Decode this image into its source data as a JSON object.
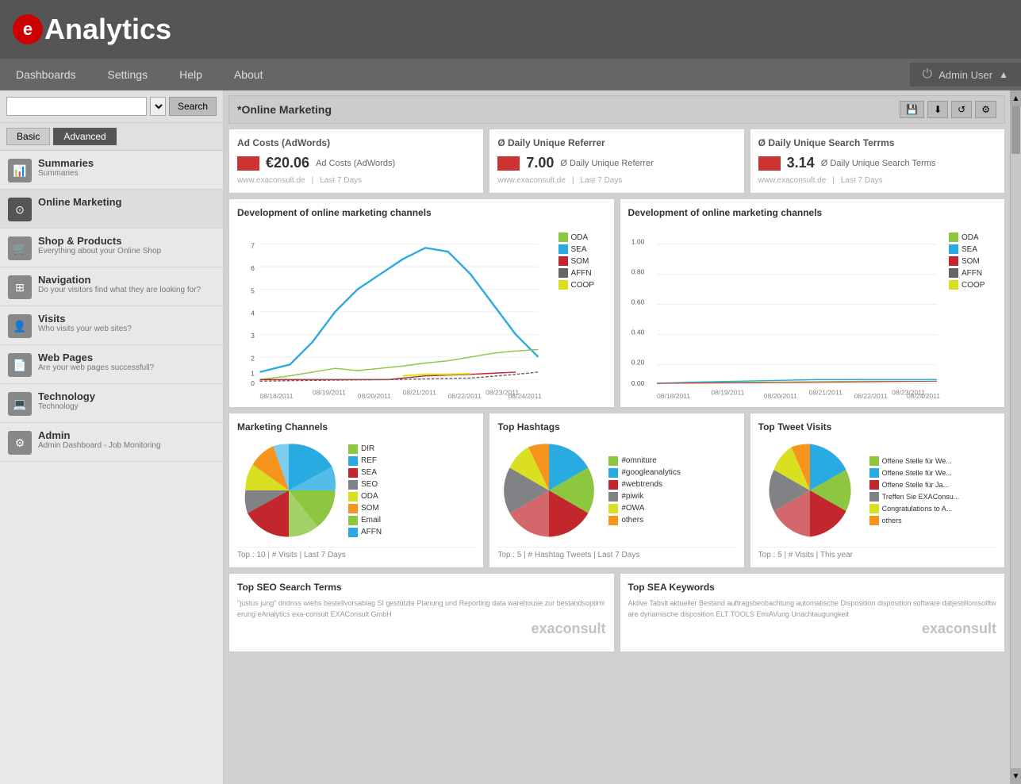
{
  "header": {
    "logo_letter": "e",
    "title": "Analytics"
  },
  "navbar": {
    "items": [
      "Dashboards",
      "Settings",
      "Help",
      "About"
    ],
    "user": "Admin User"
  },
  "sidebar": {
    "search_placeholder": "",
    "search_button": "Search",
    "tab_basic": "Basic",
    "tab_advanced": "Advanced",
    "items": [
      {
        "id": "summaries",
        "icon": "📊",
        "title": "Summaries",
        "sub": "Summaries"
      },
      {
        "id": "online-marketing",
        "icon": "⊙",
        "title": "Online Marketing",
        "sub": ""
      },
      {
        "id": "shop-products",
        "icon": "🛒",
        "title": "Shop & Products",
        "sub": "Everything about your Online Shop"
      },
      {
        "id": "navigation",
        "icon": "⊞",
        "title": "Navigation",
        "sub": "Do your visitors find what they are looking for?"
      },
      {
        "id": "visits",
        "icon": "👤",
        "title": "Visits",
        "sub": "Who visits your web sites?"
      },
      {
        "id": "web-pages",
        "icon": "📄",
        "title": "Web Pages",
        "sub": "Are your web pages successfull?"
      },
      {
        "id": "technology",
        "icon": "💻",
        "title": "Technology",
        "sub": "Technology"
      },
      {
        "id": "admin",
        "icon": "⚙",
        "title": "Admin",
        "sub": "Admin Dashboard - Job Monitoring"
      }
    ]
  },
  "content": {
    "page_title": "*Online Marketing",
    "toolbar_buttons": [
      "💾",
      "⬇",
      "↺",
      "⚙"
    ],
    "cards": [
      {
        "title": "Ad Costs (AdWords)",
        "color": "#c33",
        "value": "€20.06",
        "label": "Ad Costs (AdWords)",
        "site": "www.exaconsult.de",
        "period": "Last 7 Days"
      },
      {
        "title": "Ø Daily Unique Referrer",
        "color": "#c33",
        "value": "7.00",
        "label": "Ø Daily Unique Referrer",
        "site": "www.exaconsult.de",
        "period": "Last 7 Days"
      },
      {
        "title": "Ø Daily Unique Search Terrms",
        "color": "#c33",
        "value": "3.14",
        "label": "Ø Daily Unique Search Terms",
        "site": "www.exaconsult.de",
        "period": "Last 7 Days"
      }
    ],
    "line_charts": [
      {
        "title": "Development of online marketing channels",
        "legend": [
          {
            "label": "ODA",
            "color": "#8dc63f"
          },
          {
            "label": "SEA",
            "color": "#29abe2"
          },
          {
            "label": "SOM",
            "color": "#c1272d"
          },
          {
            "label": "AFFN",
            "color": "#666"
          },
          {
            "label": "COOP",
            "color": "#d9e021"
          }
        ]
      },
      {
        "title": "Development of online marketing channels",
        "legend": [
          {
            "label": "ODA",
            "color": "#8dc63f"
          },
          {
            "label": "SEA",
            "color": "#29abe2"
          },
          {
            "label": "SOM",
            "color": "#c1272d"
          },
          {
            "label": "AFFN",
            "color": "#666"
          },
          {
            "label": "COOP",
            "color": "#d9e021"
          }
        ]
      }
    ],
    "pie_charts": [
      {
        "title": "Marketing Channels",
        "legend": [
          {
            "label": "DIR",
            "color": "#8dc63f"
          },
          {
            "label": "REF",
            "color": "#29abe2"
          },
          {
            "label": "SEA",
            "color": "#c1272d"
          },
          {
            "label": "SEO",
            "color": "#808285"
          },
          {
            "label": "ODA",
            "color": "#d9e021"
          },
          {
            "label": "SOM",
            "color": "#f7941d"
          },
          {
            "label": "Email",
            "color": "#8dc63f"
          },
          {
            "label": "AFFN",
            "color": "#29abe2"
          }
        ],
        "footer": "Top : 10  |  # Visits  |  Last 7 Days",
        "segments": [
          {
            "color": "#29abe2",
            "start": 0,
            "end": 0.35
          },
          {
            "color": "#8dc63f",
            "start": 0.35,
            "end": 0.55
          },
          {
            "color": "#c1272d",
            "start": 0.55,
            "end": 0.72
          },
          {
            "color": "#808285",
            "start": 0.72,
            "end": 0.82
          },
          {
            "color": "#d9e021",
            "start": 0.82,
            "end": 0.88
          },
          {
            "color": "#f7941d",
            "start": 0.88,
            "end": 0.93
          },
          {
            "color": "#29abe2",
            "start": 0.93,
            "end": 0.97
          },
          {
            "color": "#8dc63f",
            "start": 0.97,
            "end": 1.0
          }
        ]
      },
      {
        "title": "Top Hashtags",
        "legend": [
          {
            "label": "#omniture",
            "color": "#8dc63f"
          },
          {
            "label": "#googleanalytics",
            "color": "#29abe2"
          },
          {
            "label": "#webtrends",
            "color": "#c1272d"
          },
          {
            "label": "#piwik",
            "color": "#808285"
          },
          {
            "label": "#OWA",
            "color": "#d9e021"
          },
          {
            "label": "others",
            "color": "#f7941d"
          }
        ],
        "footer": "Top : 5  |  # Hashtag Tweets  |  Last 7 Days",
        "segments": [
          {
            "color": "#29abe2",
            "start": 0,
            "end": 0.28
          },
          {
            "color": "#8dc63f",
            "start": 0.28,
            "end": 0.5
          },
          {
            "color": "#c1272d",
            "start": 0.5,
            "end": 0.68
          },
          {
            "color": "#808285",
            "start": 0.68,
            "end": 0.8
          },
          {
            "color": "#d9e021",
            "start": 0.8,
            "end": 0.88
          },
          {
            "color": "#f7941d",
            "start": 0.88,
            "end": 1.0
          }
        ]
      },
      {
        "title": "Top Tweet Visits",
        "legend": [
          {
            "label": "Offene Stelle für We...",
            "color": "#8dc63f"
          },
          {
            "label": "Offene Stelle für We...",
            "color": "#29abe2"
          },
          {
            "label": "Offene Stelle für Ja...",
            "color": "#c1272d"
          },
          {
            "label": "Treffen Sie EXAConsu...",
            "color": "#808285"
          },
          {
            "label": "Congratulations to A...",
            "color": "#d9e021"
          },
          {
            "label": "others",
            "color": "#f7941d"
          }
        ],
        "footer": "Top : 5  |  # Visits  |  This year",
        "segments": [
          {
            "color": "#29abe2",
            "start": 0,
            "end": 0.3
          },
          {
            "color": "#8dc63f",
            "start": 0.3,
            "end": 0.52
          },
          {
            "color": "#c1272d",
            "start": 0.52,
            "end": 0.68
          },
          {
            "color": "#808285",
            "start": 0.68,
            "end": 0.8
          },
          {
            "color": "#d9e021",
            "start": 0.8,
            "end": 0.9
          },
          {
            "color": "#f7941d",
            "start": 0.9,
            "end": 1.0
          }
        ]
      }
    ],
    "seo_panels": [
      {
        "title": "Top SEO Search Terms",
        "content": "\"justus jung\" dndnss wiehs bestellvorsablag SI gestützte Planung und Reporting\ndata warehouse zur bestandsoptimierung eAnalytics exa-consult EXAConsult GmbH",
        "brand": "exaconsult"
      },
      {
        "title": "Top SEA Keywords",
        "content": "Aktive Tabslt aktueller Bestand auftragsbeobachtung automatische Disposition disposition software\ndatjestillomsolftware dynamische disposition ELT TOOLS EmiAVung Unachtaugungkeit",
        "brand": "exaconsult"
      }
    ]
  }
}
